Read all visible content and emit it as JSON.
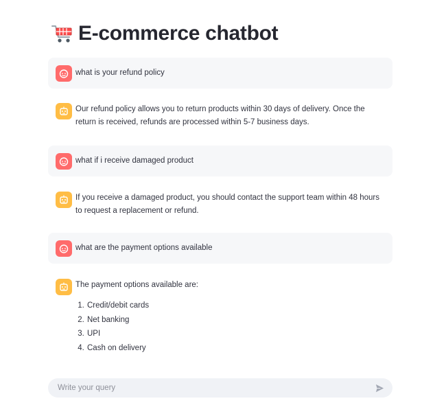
{
  "header": {
    "title": "E-commerce chatbot",
    "icon": "shopping-cart-icon"
  },
  "messages": [
    {
      "role": "user",
      "avatar_icon": "user-face-icon",
      "text": "what is your refund policy"
    },
    {
      "role": "assistant",
      "avatar_icon": "robot-icon",
      "text": "Our refund policy allows you to return products within 30 days of delivery. Once the return is received, refunds are processed within 5-7 business days."
    },
    {
      "role": "user",
      "avatar_icon": "user-face-icon",
      "text": "what if i receive damaged product"
    },
    {
      "role": "assistant",
      "avatar_icon": "robot-icon",
      "text": "If you receive a damaged product, you should contact the support team within 48 hours to request a replacement or refund."
    },
    {
      "role": "user",
      "avatar_icon": "user-face-icon",
      "text": "what are the payment options available"
    },
    {
      "role": "assistant",
      "avatar_icon": "robot-icon",
      "text": "The payment options available are:",
      "list": [
        "Credit/debit cards",
        "Net banking",
        "UPI",
        "Cash on delivery"
      ]
    }
  ],
  "chat_input": {
    "placeholder": "Write your query",
    "value": "",
    "send_icon": "send-icon"
  },
  "colors": {
    "user_avatar": "#ff6b6b",
    "assistant_avatar": "#ffbd45",
    "user_bubble": "#f6f7f9",
    "input_background": "#f0f2f6"
  }
}
